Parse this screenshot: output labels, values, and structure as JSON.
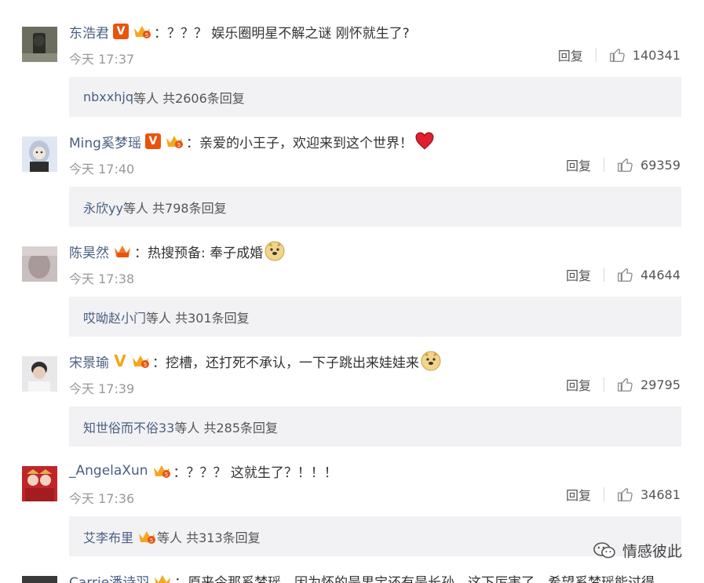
{
  "comments": [
    {
      "username": "东浩君",
      "badge": "V",
      "badge_color": "#e8540e",
      "text": "：？？？ 娱乐圈明星不解之谜 刚怀就生了?",
      "emoji": "",
      "time": "今天 17:37",
      "reply_label": "回复",
      "likes": "140341",
      "sub_user": "nbxxhjq",
      "sub_tail": " 等人 共2606条回复"
    },
    {
      "username": "Ming奚梦瑶",
      "badge": "V",
      "badge_color": "#e8540e",
      "text": "：亲爱的小王子，欢迎来到这个世界！",
      "emoji": "heart-icon",
      "time": "今天 17:40",
      "reply_label": "回复",
      "likes": "69359",
      "sub_user": "永欣yy",
      "sub_tail": " 等人 共798条回复"
    },
    {
      "username": "陈昊然",
      "badge": "",
      "text": "：热搜预备: 奉子成婚",
      "emoji": "doge-icon",
      "time": "今天 17:38",
      "reply_label": "回复",
      "likes": "44644",
      "sub_user": "哎呦赵小门",
      "sub_tail": " 等人 共301条回复"
    },
    {
      "username": "宋景瑜",
      "badge": "V",
      "badge_color": "#f0a814",
      "text": "：挖槽，还打死不承认，一下子跳出来娃娃来",
      "emoji": "doge-icon",
      "time": "今天 17:39",
      "reply_label": "回复",
      "likes": "29795",
      "sub_user": "知世俗而不俗33",
      "sub_tail": " 等人 共285条回复"
    },
    {
      "username": "_AngelaXun",
      "badge": "",
      "text": "：？？？ 这就生了？！！！",
      "emoji": "",
      "time": "今天 17:36",
      "reply_label": "回复",
      "likes": "34681",
      "sub_user": "艾李布里",
      "sub_tail": " 等人 共313条回复"
    }
  ],
  "partial_comment": {
    "username": "Carrie潘诗羽",
    "text": "：原来今那奚梦瑶，因为怀的是男宝还有是长孙，这下厉害了，希望奚梦瑶能过得"
  },
  "watermark": "情感彼此"
}
